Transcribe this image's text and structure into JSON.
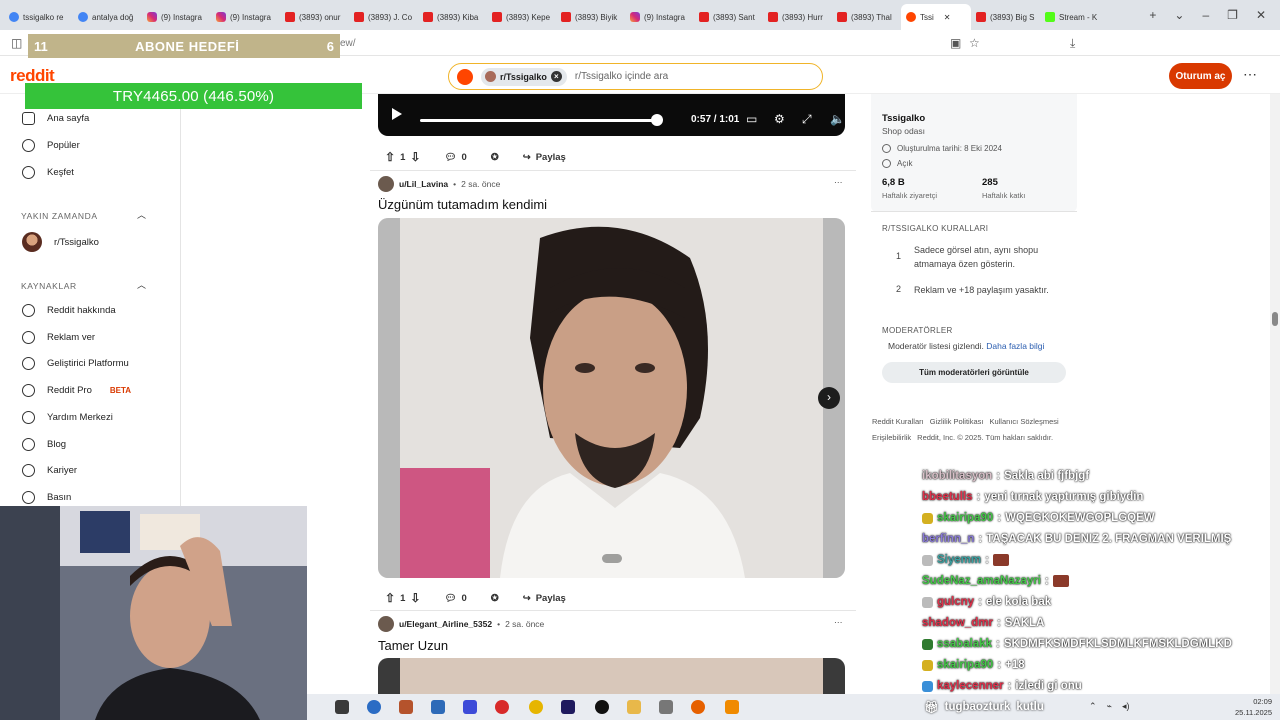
{
  "browser": {
    "tabs": [
      {
        "label": "tssigalko re",
        "fav": "g"
      },
      {
        "label": "antalya doğ",
        "fav": "g"
      },
      {
        "label": "(9) Instagra",
        "fav": "ig"
      },
      {
        "label": "(9) Instagra",
        "fav": "ig"
      },
      {
        "label": "(3893) onur",
        "fav": "yt"
      },
      {
        "label": "(3893) J. Co",
        "fav": "yt"
      },
      {
        "label": "(3893) Kiba",
        "fav": "yt"
      },
      {
        "label": "(3893) Kepe",
        "fav": "yt"
      },
      {
        "label": "(3893) Biyik",
        "fav": "yt"
      },
      {
        "label": "(9) Instagra",
        "fav": "ig"
      },
      {
        "label": "(3893) Sant",
        "fav": "yt"
      },
      {
        "label": "(3893) Hurr",
        "fav": "yt"
      },
      {
        "label": "(3893) Thal",
        "fav": "yt"
      },
      {
        "label": "Tssi",
        "fav": "rd",
        "active": true
      },
      {
        "label": "(3893) Big S",
        "fav": "yt"
      },
      {
        "label": "Stream - K",
        "fav": "kick"
      }
    ],
    "url_tail": "ew/"
  },
  "overlay": {
    "sub_goal": {
      "left": "11",
      "title": "ABONE HEDEFİ",
      "right": "6"
    },
    "donation": "TRY4465.00 (446.50%)"
  },
  "header": {
    "logo": "reddit",
    "search_chip": "r/Tssigalko",
    "search_placeholder": "r/Tssigalko içinde ara",
    "login": "Oturum aç",
    "more": "⋯"
  },
  "leftnav": {
    "items_top": [
      {
        "label": "Ana sayfa",
        "icon": "home-icon"
      },
      {
        "label": "Popüler",
        "icon": "popular-icon"
      },
      {
        "label": "Keşfet",
        "icon": "explore-icon"
      }
    ],
    "recent_title": "YAKIN ZAMANDA",
    "recent_items": [
      {
        "label": "r/Tssigalko"
      }
    ],
    "resources_title": "KAYNAKLAR",
    "resources": [
      {
        "label": "Reddit hakkında",
        "icon": "reddit-icon"
      },
      {
        "label": "Reklam ver",
        "icon": "megaphone-icon"
      },
      {
        "label": "Geliştirici Platformu",
        "icon": "dev-platform-icon"
      },
      {
        "label": "Reddit Pro",
        "icon": "pro-icon",
        "badge": "BETA"
      },
      {
        "label": "Yardım Merkezi",
        "icon": "help-icon"
      },
      {
        "label": "Blog",
        "icon": "blog-icon"
      },
      {
        "label": "Kariyer",
        "icon": "career-icon"
      },
      {
        "label": "Basın",
        "icon": "press-icon"
      }
    ]
  },
  "feed": {
    "video": {
      "time": "0:57 / 1:01",
      "progress": 0.92
    },
    "post0_actions": {
      "votes": "1",
      "comments": "0",
      "share": "Paylaş"
    },
    "post1": {
      "user": "u/Lil_Lavina",
      "age": "2 sa. önce",
      "title": "Üzgünüm tutamadım kendimi",
      "votes": "1",
      "comments": "0",
      "share": "Paylaş"
    },
    "post2": {
      "user": "u/Elegant_Airline_5352",
      "age": "2 sa. önce",
      "title": "Tamer Uzun"
    }
  },
  "sidebar": {
    "name": "Tssigalko",
    "subtitle": "Shop odası",
    "created": "Oluşturulma tarihi: 8 Eki 2024",
    "visibility": "Açık",
    "stat1_value": "6,8 B",
    "stat1_label": "Haftalık ziyaretçi",
    "stat2_value": "285",
    "stat2_label": "Haftalık katkı",
    "rules_title": "R/TSSIGALKO KURALLARI",
    "rules": [
      {
        "num": "1",
        "text": "Sadece görsel atın, aynı shopu atmamaya özen gösterin."
      },
      {
        "num": "2",
        "text": "Reklam ve +18 paylaşım yasaktır."
      }
    ],
    "mods_title": "MODERATÖRLER",
    "mods_text": "Moderatör listesi gizlendi.",
    "mods_link": "Daha fazla bilgi",
    "mods_button": "Tüm moderatörleri görüntüle",
    "footer_row1": [
      "Reddit Kuralları",
      "Gizlilik Politikası",
      "Kullanıcı Sözleşmesi"
    ],
    "footer_row2": [
      "Erişilebilirlik",
      "Reddit, Inc. © 2025. Tüm hakları saklıdır."
    ]
  },
  "chat": [
    {
      "user": "ikobilitasyon",
      "color": "#d8c0c8",
      "msg": "Sakla abi fjfbjgf"
    },
    {
      "user": "bbeetulls",
      "color": "#e0314b",
      "msg": "yeni tırnak yaptırmış gibiydin"
    },
    {
      "user": "skairipa90",
      "color": "#46c94a",
      "msg": "WQEGKOKEWGOPLGQEW",
      "badge": "#d4b020"
    },
    {
      "user": "berfinn_n",
      "color": "#8a7bd8",
      "msg": "TAŞACAK BU DENIZ 2. FRAGMAN VERILMIŞ"
    },
    {
      "user": "Siyemm",
      "color": "#3aa0a0",
      "msg": "",
      "badge": "#bbbbbb",
      "emote": true
    },
    {
      "user": "SudeNaz_amaNazayri",
      "color": "#46c94a",
      "msg": "",
      "emote": true
    },
    {
      "user": "gulcny",
      "color": "#e0314b",
      "msg": "ele kola bak",
      "badge": "#bbbbbb"
    },
    {
      "user": "shadow_dmr",
      "color": "#e0314b",
      "msg": "SAKLA"
    },
    {
      "user": "ssabalakk",
      "color": "#46c94a",
      "msg": "SKDMFKSMDFKLSDMLKFMSKLDGMLKD",
      "badge": "#2f7a2f"
    },
    {
      "user": "skairipa90",
      "color": "#46c94a",
      "msg": "+18",
      "badge": "#d4b020"
    },
    {
      "user": "kaylecenner",
      "color": "#e0314b",
      "msg": "izledi gi onu",
      "badge": "#3a8fd8"
    }
  ],
  "alert": {
    "user": "tugbaozturk",
    "msg": "kutlu"
  },
  "taskbar": {
    "time": "02:09",
    "date": "25.11.2025"
  }
}
